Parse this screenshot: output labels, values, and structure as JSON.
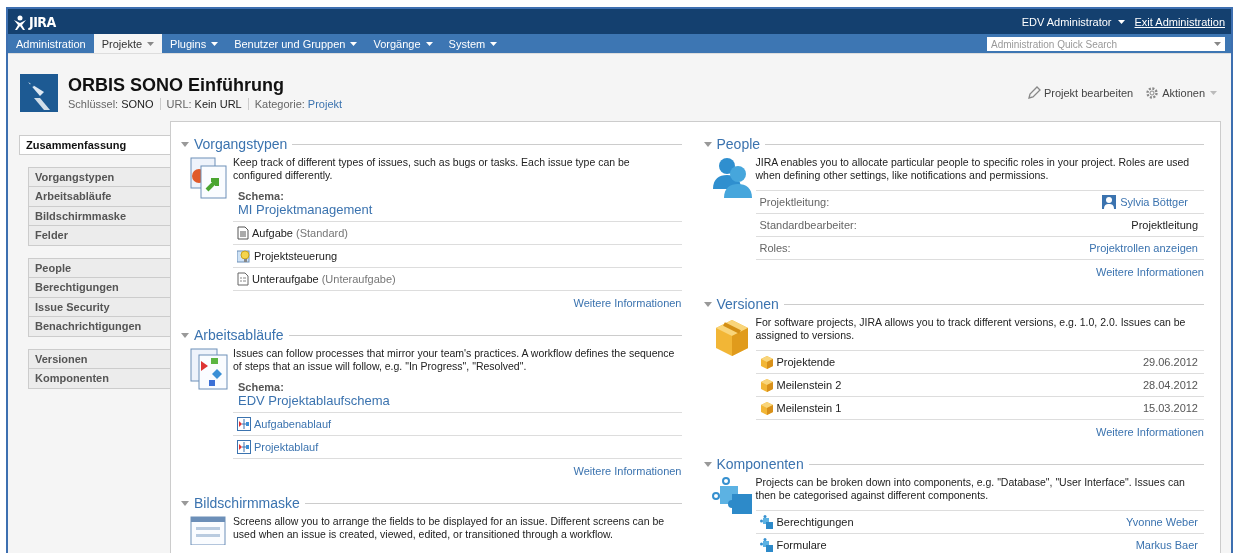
{
  "header": {
    "logo": "JIRA",
    "user": "EDV Administrator",
    "exit_link": "Exit Administration"
  },
  "nav": {
    "items": [
      {
        "label": "Administration",
        "dropdown": false,
        "selected": false
      },
      {
        "label": "Projekte",
        "dropdown": true,
        "selected": true
      },
      {
        "label": "Plugins",
        "dropdown": true,
        "selected": false
      },
      {
        "label": "Benutzer und Gruppen",
        "dropdown": true,
        "selected": false
      },
      {
        "label": "Vorgänge",
        "dropdown": true,
        "selected": false
      },
      {
        "label": "System",
        "dropdown": true,
        "selected": false
      }
    ],
    "search": {
      "placeholder": "Administration Quick Search"
    }
  },
  "project": {
    "name": "ORBIS SONO Einführung",
    "meta": [
      {
        "label": "Schlüssel:",
        "value": "SONO",
        "link": false
      },
      {
        "label": "URL:",
        "value": "Kein URL",
        "link": false
      },
      {
        "label": "Kategorie:",
        "value": "Projekt",
        "link": true
      }
    ],
    "actions": [
      {
        "kind": "edit",
        "label": "Projekt bearbeiten",
        "dropdown": false
      },
      {
        "kind": "gear",
        "label": "Aktionen",
        "dropdown": true
      }
    ]
  },
  "sidebar": {
    "groups": [
      [
        {
          "label": "Zusammenfassung",
          "selected": true
        }
      ],
      [
        {
          "label": "Vorgangstypen",
          "selected": false
        },
        {
          "label": "Arbeitsabläufe",
          "selected": false
        },
        {
          "label": "Bildschirmmaske",
          "selected": false
        },
        {
          "label": "Felder",
          "selected": false
        }
      ],
      [
        {
          "label": "People",
          "selected": false
        },
        {
          "label": "Berechtigungen",
          "selected": false
        },
        {
          "label": "Issue Security",
          "selected": false
        },
        {
          "label": "Benachrichtigungen",
          "selected": false
        }
      ],
      [
        {
          "label": "Versionen",
          "selected": false
        },
        {
          "label": "Komponenten",
          "selected": false
        }
      ]
    ]
  },
  "columns": [
    [
      {
        "title": "Vorgangstypen",
        "kind": "types",
        "description": "Keep track of different types of issues, such as bugs or tasks. Each issue type can be configured differently.",
        "schema_label": "Schema:",
        "schema": "MI Projektmanagement",
        "rows": [
          {
            "kind": "task",
            "name": "Aufgabe",
            "note": "(Standard)"
          },
          {
            "kind": "idea",
            "name": "Projektsteuerung"
          },
          {
            "kind": "subtask",
            "name": "Unteraufgabe",
            "note": "(Unteraufgabe)"
          }
        ],
        "more": "Weitere Informationen"
      },
      {
        "title": "Arbeitsabläufe",
        "kind": "workflows",
        "description": "Issues can follow processes that mirror your team's practices. A workflow defines the sequence of steps that an issue will follow, e.g. \"In Progress\", \"Resolved\".",
        "schema_label": "Schema:",
        "schema": "EDV Projektablaufschema",
        "rows": [
          {
            "kind": "workflow",
            "name": "Aufgabenablauf"
          },
          {
            "kind": "workflow",
            "name": "Projektablauf"
          }
        ],
        "more": "Weitere Informationen"
      },
      {
        "title": "Bildschirmmaske",
        "kind": "screens",
        "description": "Screens allow you to arrange the fields to be displayed for an issue. Different screens can be used when an issue is created, viewed, edited, or transitioned through a workflow."
      }
    ],
    [
      {
        "title": "People",
        "kind": "people",
        "description": "JIRA enables you to allocate particular people to specific roles in your project. Roles are used when defining other settings, like notifications and permissions.",
        "rows": [
          {
            "kind": "user",
            "name": "Projektleitung:",
            "value": "Sylvia Böttger"
          },
          {
            "kind": "plain",
            "name": "Standardbearbeiter:",
            "value": "Projektleitung"
          },
          {
            "kind": "link",
            "name": "Roles:",
            "value": "Projektrollen anzeigen"
          }
        ],
        "more": "Weitere Informationen"
      },
      {
        "title": "Versionen",
        "kind": "versions",
        "description": "For software projects, JIRA allows you to track different versions, e.g. 1.0, 2.0. Issues can be assigned to versions.",
        "rows": [
          {
            "kind": "version",
            "name": "Projektende",
            "value": "29.06.2012"
          },
          {
            "kind": "version",
            "name": "Meilenstein 2",
            "value": "28.04.2012"
          },
          {
            "kind": "version",
            "name": "Meilenstein 1",
            "value": "15.03.2012"
          }
        ],
        "more": "Weitere Informationen"
      },
      {
        "title": "Komponenten",
        "kind": "components",
        "description": "Projects can be broken down into components, e.g. \"Database\", \"User Interface\". Issues can then be categorised against different components.",
        "rows": [
          {
            "kind": "component",
            "name": "Berechtigungen",
            "value": "Yvonne Weber"
          },
          {
            "kind": "component",
            "name": "Formulare",
            "value": "Markus Baer"
          }
        ]
      }
    ]
  ]
}
